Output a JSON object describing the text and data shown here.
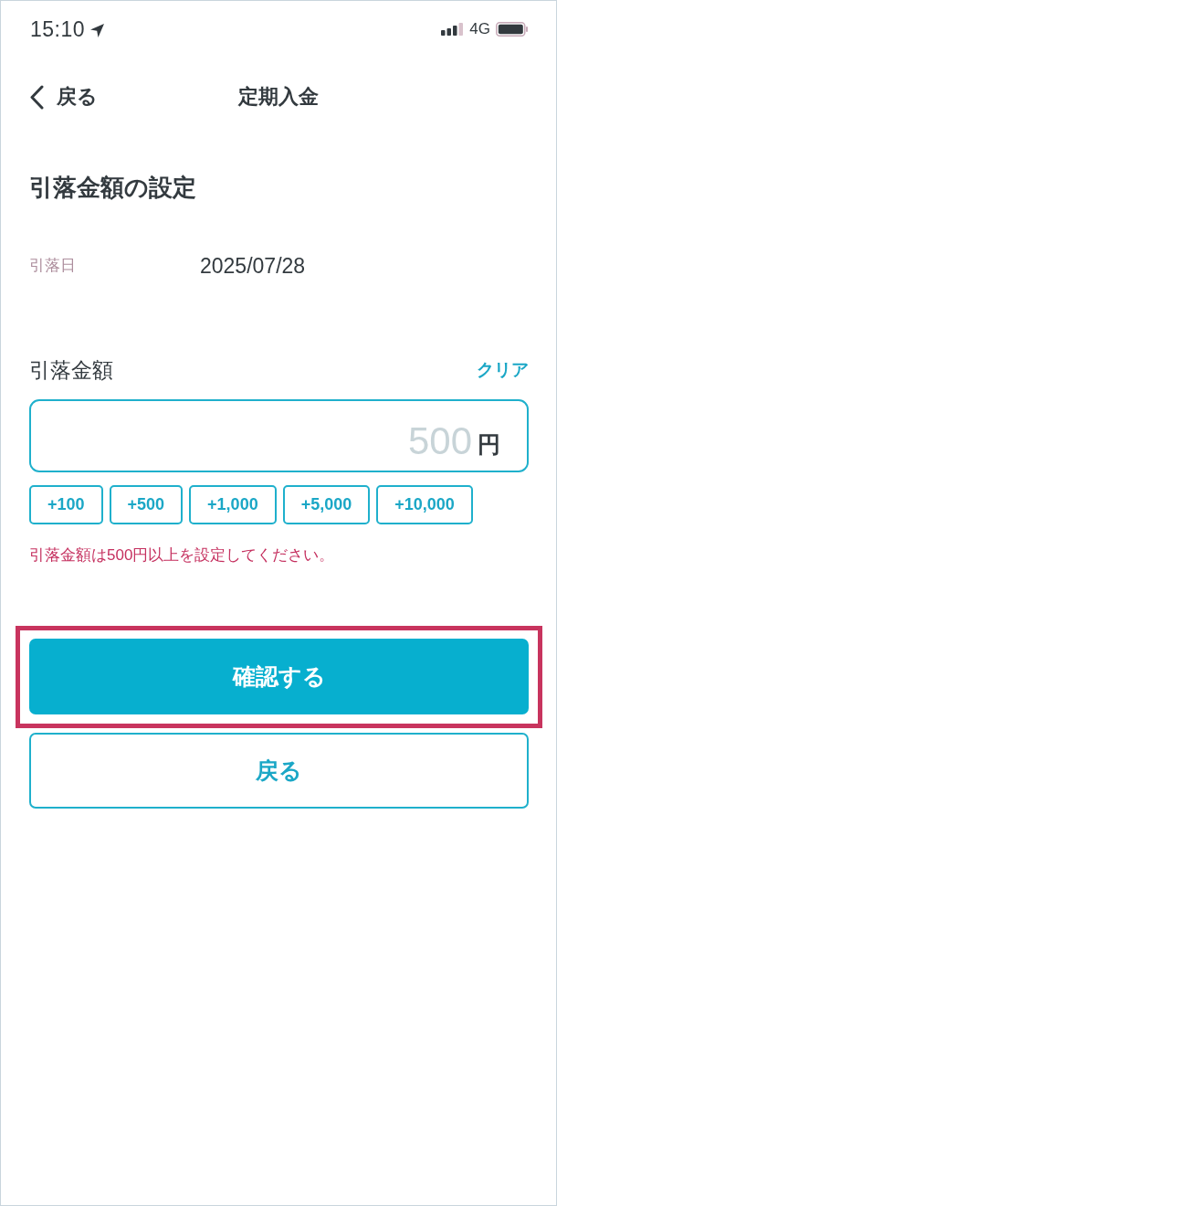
{
  "status_bar": {
    "time": "15:10",
    "network": "4G"
  },
  "nav": {
    "back_label": "戻る",
    "title": "定期入金"
  },
  "heading": "引落金額の設定",
  "date_row": {
    "label": "引落日",
    "value": "2025/07/28"
  },
  "amount": {
    "label": "引落金額",
    "clear_label": "クリア",
    "placeholder": "500",
    "unit": "円"
  },
  "increments": [
    "+100",
    "+500",
    "+1,000",
    "+5,000",
    "+10,000"
  ],
  "error": "引落金額は500円以上を設定してください。",
  "buttons": [
    {
      "kind": "primary",
      "label": "確認する",
      "highlighted": true
    },
    {
      "kind": "secondary",
      "label": "戻る",
      "highlighted": false
    }
  ]
}
